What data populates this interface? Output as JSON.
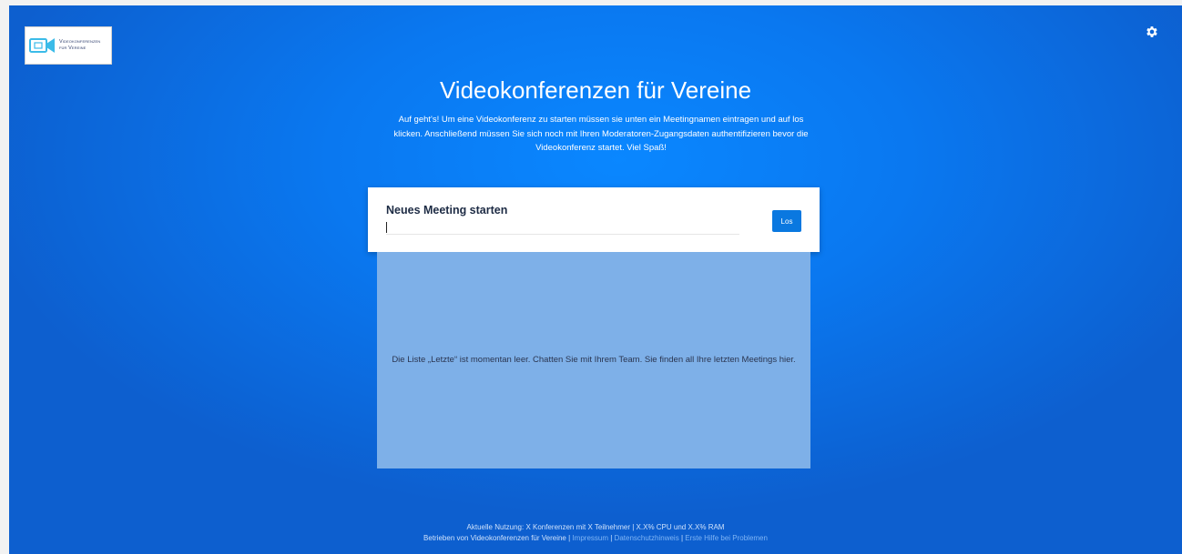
{
  "logo": {
    "line1": "Videokonferenzen",
    "line2": "für Vereine"
  },
  "header": {
    "settings_icon": "gear-icon",
    "title": "Videokonferenzen für Vereine",
    "intro": "Auf geht's! Um eine Videokonferenz zu starten müssen sie unten ein Meetingnamen eintragen und auf los klicken. Anschließend müssen Sie sich noch mit Ihren Moderatoren-Zugangsdaten authentifizieren bevor die Videokonferenz startet. Viel Spaß!"
  },
  "meeting": {
    "heading": "Neues Meeting starten",
    "input_value": "",
    "button_label": "Los"
  },
  "recent": {
    "empty_message": "Die Liste „Letzte“ ist momentan leer. Chatten Sie mit Ihrem Team. Sie finden all Ihre letzten Meetings hier."
  },
  "footer": {
    "usage": "Aktuelle Nutzung: X Konferenzen mit X Teilnehmer | X.X% CPU und X.X% RAM",
    "operated_by": "Betrieben von Videokonferenzen für Vereine",
    "separator": "|",
    "links": [
      "Impressum",
      "Datenschutzhinweis",
      "Erste Hilfe bei Problemen"
    ]
  },
  "colors": {
    "background": "#0a78f0",
    "button": "#0a78e0",
    "recent_panel": "#7eb0e8",
    "footer_link": "#7fb5f5"
  }
}
